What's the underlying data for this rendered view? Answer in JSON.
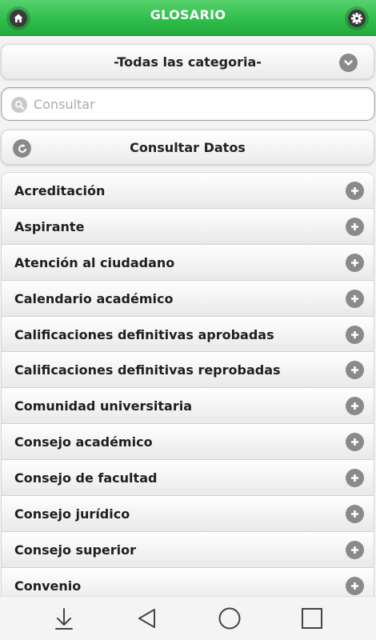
{
  "header": {
    "title": "GLOSARIO",
    "home_icon": "home-icon",
    "settings_icon": "gear-icon"
  },
  "category_select": {
    "selected": "-Todas las categoria-",
    "icon": "chevron-down-icon"
  },
  "search": {
    "placeholder": "Consultar",
    "value": ""
  },
  "consult_button": {
    "label": "Consultar Datos",
    "icon": "refresh-icon"
  },
  "glossary": {
    "items": [
      {
        "label": "Acreditación"
      },
      {
        "label": "Aspirante"
      },
      {
        "label": "Atención al ciudadano"
      },
      {
        "label": "Calendario académico"
      },
      {
        "label": "Calificaciones definitivas aprobadas"
      },
      {
        "label": "Calificaciones definitivas reprobadas"
      },
      {
        "label": "Comunidad universitaria"
      },
      {
        "label": "Consejo académico"
      },
      {
        "label": "Consejo de facultad"
      },
      {
        "label": "Consejo jurídico"
      },
      {
        "label": "Consejo superior"
      },
      {
        "label": "Convenio"
      }
    ]
  },
  "colors": {
    "header_green": "#2fbf4b",
    "icon_gray": "#8a8a8a"
  }
}
